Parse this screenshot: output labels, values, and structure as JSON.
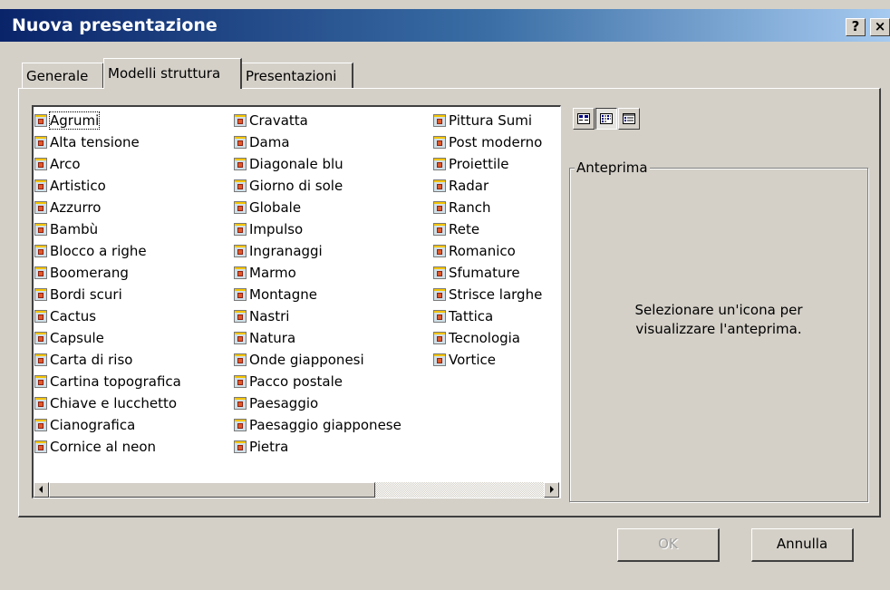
{
  "window": {
    "title": "Nuova presentazione",
    "help_button": "?",
    "close_button": "×"
  },
  "tabs": [
    {
      "label": "Generale",
      "active": false
    },
    {
      "label": "Modelli struttura",
      "active": true
    },
    {
      "label": "Presentazioni",
      "active": false
    }
  ],
  "template_list": {
    "icon": "design-template-icon",
    "columns": [
      [
        "Agrumi",
        "Alta tensione",
        "Arco",
        "Artistico",
        "Azzurro",
        "Bambù",
        "Blocco a righe",
        "Boomerang",
        "Bordi scuri",
        "Cactus",
        "Capsule",
        "Carta di riso",
        "Cartina topografica",
        "Chiave e lucchetto",
        "Cianografica",
        "Cornice al neon"
      ],
      [
        "Cravatta",
        "Dama",
        "Diagonale blu",
        "Giorno di sole",
        "Globale",
        "Impulso",
        "Ingranaggi",
        "Marmo",
        "Montagne",
        "Nastri",
        "Natura",
        "Onde giapponesi",
        "Pacco postale",
        "Paesaggio",
        "Paesaggio giapponese",
        "Pietra"
      ],
      [
        "Pittura Sumi",
        "Post moderno",
        "Proiettile",
        "Radar",
        "Ranch",
        "Rete",
        "Romanico",
        "Sfumature",
        "Strisce larghe",
        "Tattica",
        "Tecnologia",
        "Vortice"
      ]
    ],
    "focused_item": "Agrumi",
    "scrollbar_thumb_fraction": 0.66
  },
  "view_buttons": [
    {
      "name": "large-icons-view-icon",
      "pressed": false
    },
    {
      "name": "list-view-icon",
      "pressed": true
    },
    {
      "name": "details-view-icon",
      "pressed": false
    }
  ],
  "preview": {
    "legend": "Anteprima",
    "message_line1": "Selezionare un'icona per",
    "message_line2": "visualizzare l'anteprima."
  },
  "buttons": {
    "ok": {
      "label": "OK",
      "enabled": false
    },
    "cancel": {
      "label": "Annulla",
      "enabled": true
    }
  }
}
